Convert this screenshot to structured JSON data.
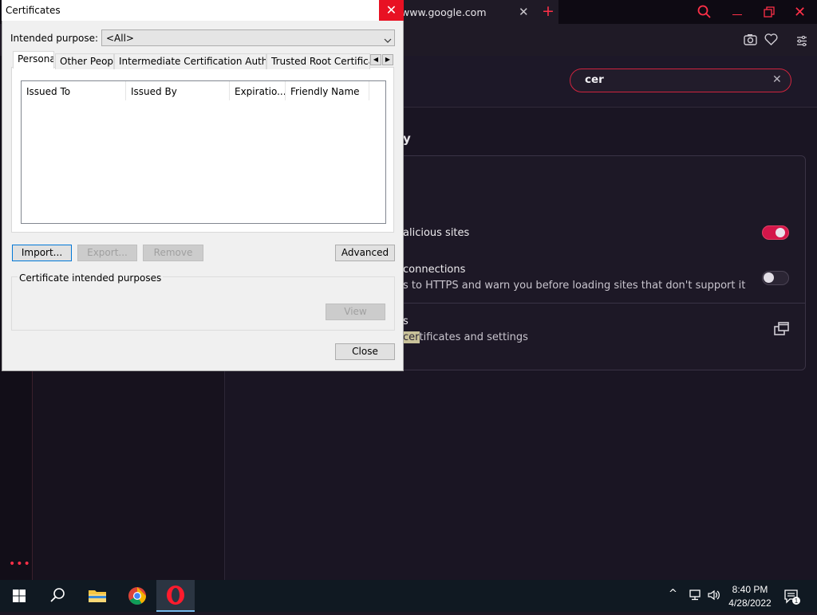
{
  "browser": {
    "tab_url": "www.google.com",
    "tab_close": "✕",
    "new_tab": "+",
    "search_query": "cer",
    "search_clear": "✕",
    "section_title": "y",
    "row1_title": "alicious sites",
    "row2_title": "connections",
    "row2_desc": "s to HTTPS and warn you before loading sites that don't support it",
    "row3_title": "s",
    "row3_desc_highlight": "cer",
    "row3_desc_rest": "tificates and settings",
    "more": "•••",
    "accent_color": "#ff3048"
  },
  "dialog": {
    "title": "Certificates",
    "close_glyph": "✕",
    "purpose_label": "Intended purpose:",
    "purpose_value": "<All>",
    "tabs": [
      "Personal",
      "Other People",
      "Intermediate Certification Authorities",
      "Trusted Root Certification"
    ],
    "columns": [
      "Issued To",
      "Issued By",
      "Expiratio...",
      "Friendly Name"
    ],
    "buttons": {
      "import": "Import...",
      "export": "Export...",
      "remove": "Remove",
      "advanced": "Advanced",
      "view": "View",
      "close": "Close"
    },
    "purposes_group": "Certificate intended purposes"
  },
  "taskbar": {
    "time": "8:40 PM",
    "date": "4/28/2022",
    "notifications": "1",
    "tray_chevron": "^"
  }
}
